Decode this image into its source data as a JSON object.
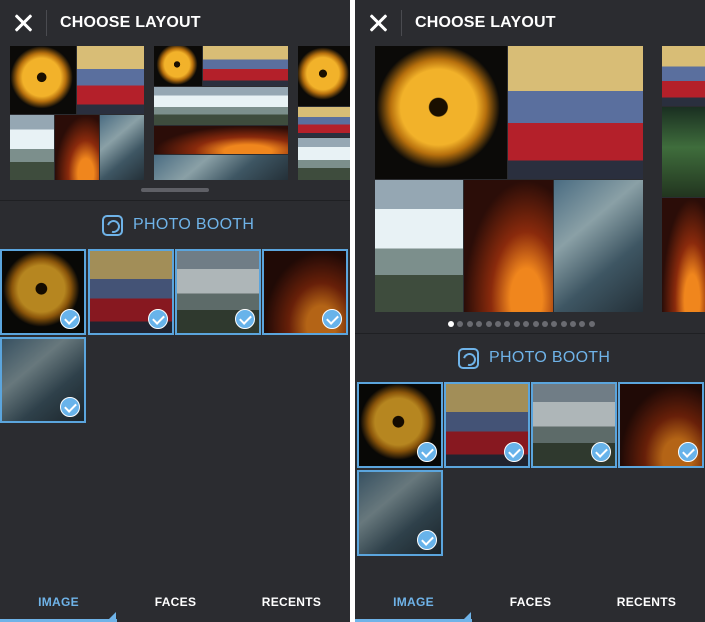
{
  "screens": [
    {
      "header": {
        "title": "CHOOSE LAYOUT",
        "close_icon": "close-icon"
      },
      "photo_booth_label": "PHOTO BOOTH",
      "tabs": [
        {
          "label": "IMAGE",
          "active": true
        },
        {
          "label": "FACES",
          "active": false
        },
        {
          "label": "RECENTS",
          "active": false
        }
      ],
      "photos": [
        {
          "subject": "golden lamp sculpture",
          "selected": true
        },
        {
          "subject": "red double-decker bus",
          "selected": true
        },
        {
          "subject": "waterfalls",
          "selected": true
        },
        {
          "subject": "lit bridge at night",
          "selected": true
        },
        {
          "subject": "city aerial view",
          "selected": true
        }
      ]
    },
    {
      "header": {
        "title": "CHOOSE LAYOUT",
        "close_icon": "close-icon"
      },
      "photo_booth_label": "PHOTO BOOTH",
      "pagination": {
        "current_page": 1,
        "total_pages": 16
      },
      "tabs": [
        {
          "label": "IMAGE",
          "active": true
        },
        {
          "label": "FACES",
          "active": false
        },
        {
          "label": "RECENTS",
          "active": false
        }
      ],
      "photos": [
        {
          "subject": "golden lamp sculpture",
          "selected": true
        },
        {
          "subject": "red double-decker bus",
          "selected": true
        },
        {
          "subject": "waterfalls",
          "selected": true
        },
        {
          "subject": "lit bridge at night",
          "selected": true
        },
        {
          "subject": "city aerial view",
          "selected": true
        }
      ]
    }
  ],
  "colors": {
    "background": "#2b2c30",
    "accent": "#6fb3e8",
    "checkmark": "#68b3ea",
    "text": "#ffffff"
  }
}
